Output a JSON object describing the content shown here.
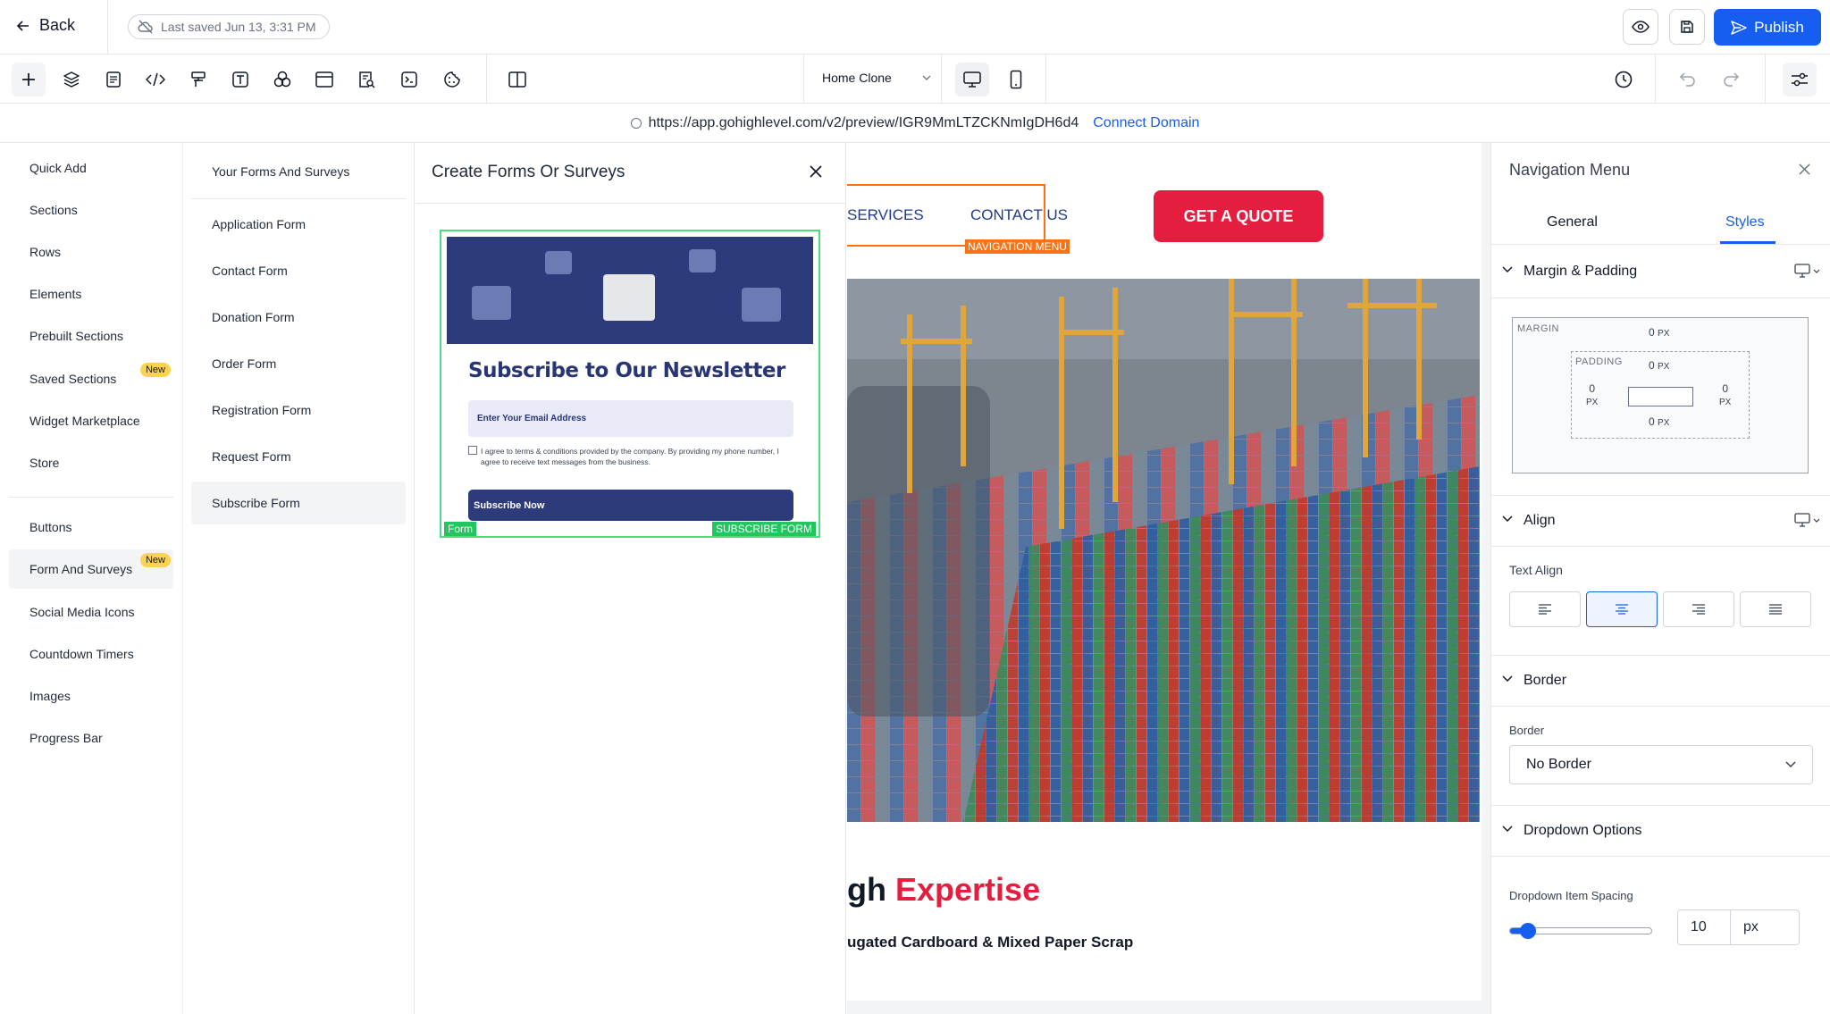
{
  "topbar": {
    "back_label": "Back",
    "saved_text": "Last saved Jun 13, 3:31 PM",
    "publish_label": "Publish"
  },
  "toolbar": {
    "page_selector": "Home Clone",
    "tools": [
      "add-icon",
      "layers-icon",
      "page-icon",
      "code-icon",
      "paint-roller-icon",
      "text-icon",
      "shapes-icon",
      "layout-icon",
      "search-doc-icon",
      "terminal-icon",
      "cookie-icon"
    ]
  },
  "urlbar": {
    "url": "https://app.gohighlevel.com/v2/preview/IGR9MmLTZCKNmIgDH6d4",
    "connect_label": "Connect Domain"
  },
  "element_panel": {
    "items": [
      {
        "label": "Quick Add"
      },
      {
        "label": "Sections"
      },
      {
        "label": "Rows"
      },
      {
        "label": "Elements"
      },
      {
        "label": "Prebuilt Sections"
      },
      {
        "label": "Saved Sections",
        "badge": "New"
      },
      {
        "label": "Widget Marketplace"
      },
      {
        "label": "Store"
      },
      {
        "label": "Buttons"
      },
      {
        "label": "Form And Surveys",
        "badge": "New"
      },
      {
        "label": "Social Media Icons"
      },
      {
        "label": "Countdown Timers"
      },
      {
        "label": "Images"
      },
      {
        "label": "Progress Bar"
      }
    ]
  },
  "form_list": {
    "header": "Your Forms And Surveys",
    "items": [
      "Application Form",
      "Contact Form",
      "Donation Form",
      "Order Form",
      "Registration Form",
      "Request Form",
      "Subscribe Form"
    ]
  },
  "create_panel": {
    "title": "Create Forms Or Surveys",
    "preview": {
      "title": "Subscribe to Our Newsletter",
      "email_placeholder": "Enter Your Email Address",
      "consent": "I agree to terms & conditions provided by the company. By providing my phone number, I agree to receive text messages from the business.",
      "button": "Subscribe Now",
      "tag_left": "Form",
      "tag_right": "SUBSCRIBE FORM"
    }
  },
  "canvas": {
    "nav_services": "SERVICES",
    "nav_contact": "CONTACT US",
    "nav_tag": "NAVIGATION MENU",
    "quote_button": "GET A QUOTE",
    "heading_prefix": "gh",
    "heading_accent": "Expertise",
    "subline": "ugated Cardboard & Mixed Paper Scrap"
  },
  "right_panel": {
    "title": "Navigation Menu",
    "tab_general": "General",
    "tab_styles": "Styles",
    "margin_padding_label": "Margin & Padding",
    "margin_label": "MARGIN",
    "padding_label": "PADDING",
    "margin_top": "0",
    "padding_top": "0",
    "padding_left": "0",
    "padding_right": "0",
    "padding_bottom": "0",
    "unit_px": "PX",
    "align_label": "Align",
    "text_align_label": "Text Align",
    "border_section": "Border",
    "border_label": "Border",
    "border_value": "No Border",
    "dropdown_options_label": "Dropdown Options",
    "dropdown_spacing_label": "Dropdown Item Spacing",
    "dropdown_spacing_value": "10",
    "dropdown_spacing_unit": "px",
    "selected_align": "center"
  },
  "colors": {
    "accent": "#155eef",
    "brand_red": "#e51d3e",
    "nav_highlight": "#f97316",
    "form_highlight": "#22c55e"
  }
}
